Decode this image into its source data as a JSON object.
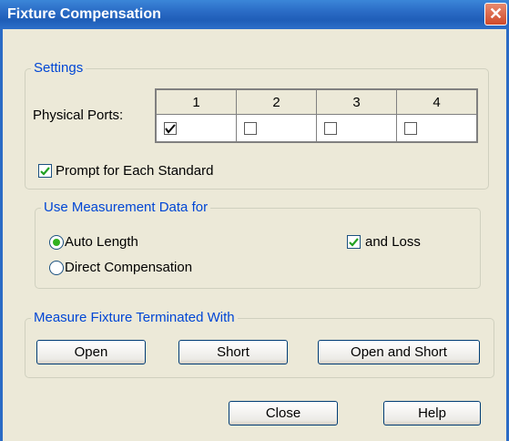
{
  "window": {
    "title": "Fixture Compensation",
    "close_glyph": "✕"
  },
  "settings": {
    "group_label": "Settings",
    "ports_label": "Physical Ports:",
    "ports": [
      {
        "label": "1",
        "checked": true
      },
      {
        "label": "2",
        "checked": false
      },
      {
        "label": "3",
        "checked": false
      },
      {
        "label": "4",
        "checked": false
      }
    ],
    "prompt_label": "Prompt for Each Standard",
    "prompt_checked": true
  },
  "measurement": {
    "group_label": "Use Measurement Data for",
    "options": [
      {
        "label": "Auto Length",
        "selected": true
      },
      {
        "label": "Direct Compensation",
        "selected": false
      }
    ],
    "loss_label": "and Loss",
    "loss_checked": true
  },
  "fixture": {
    "group_label": "Measure Fixture Terminated With",
    "buttons": {
      "open": "Open",
      "short": "Short",
      "open_short": "Open and Short"
    }
  },
  "footer": {
    "close": "Close",
    "help": "Help"
  },
  "colors": {
    "check": "#21a121",
    "group_label": "#0046d5",
    "titlebar": "#2a6bc5"
  }
}
